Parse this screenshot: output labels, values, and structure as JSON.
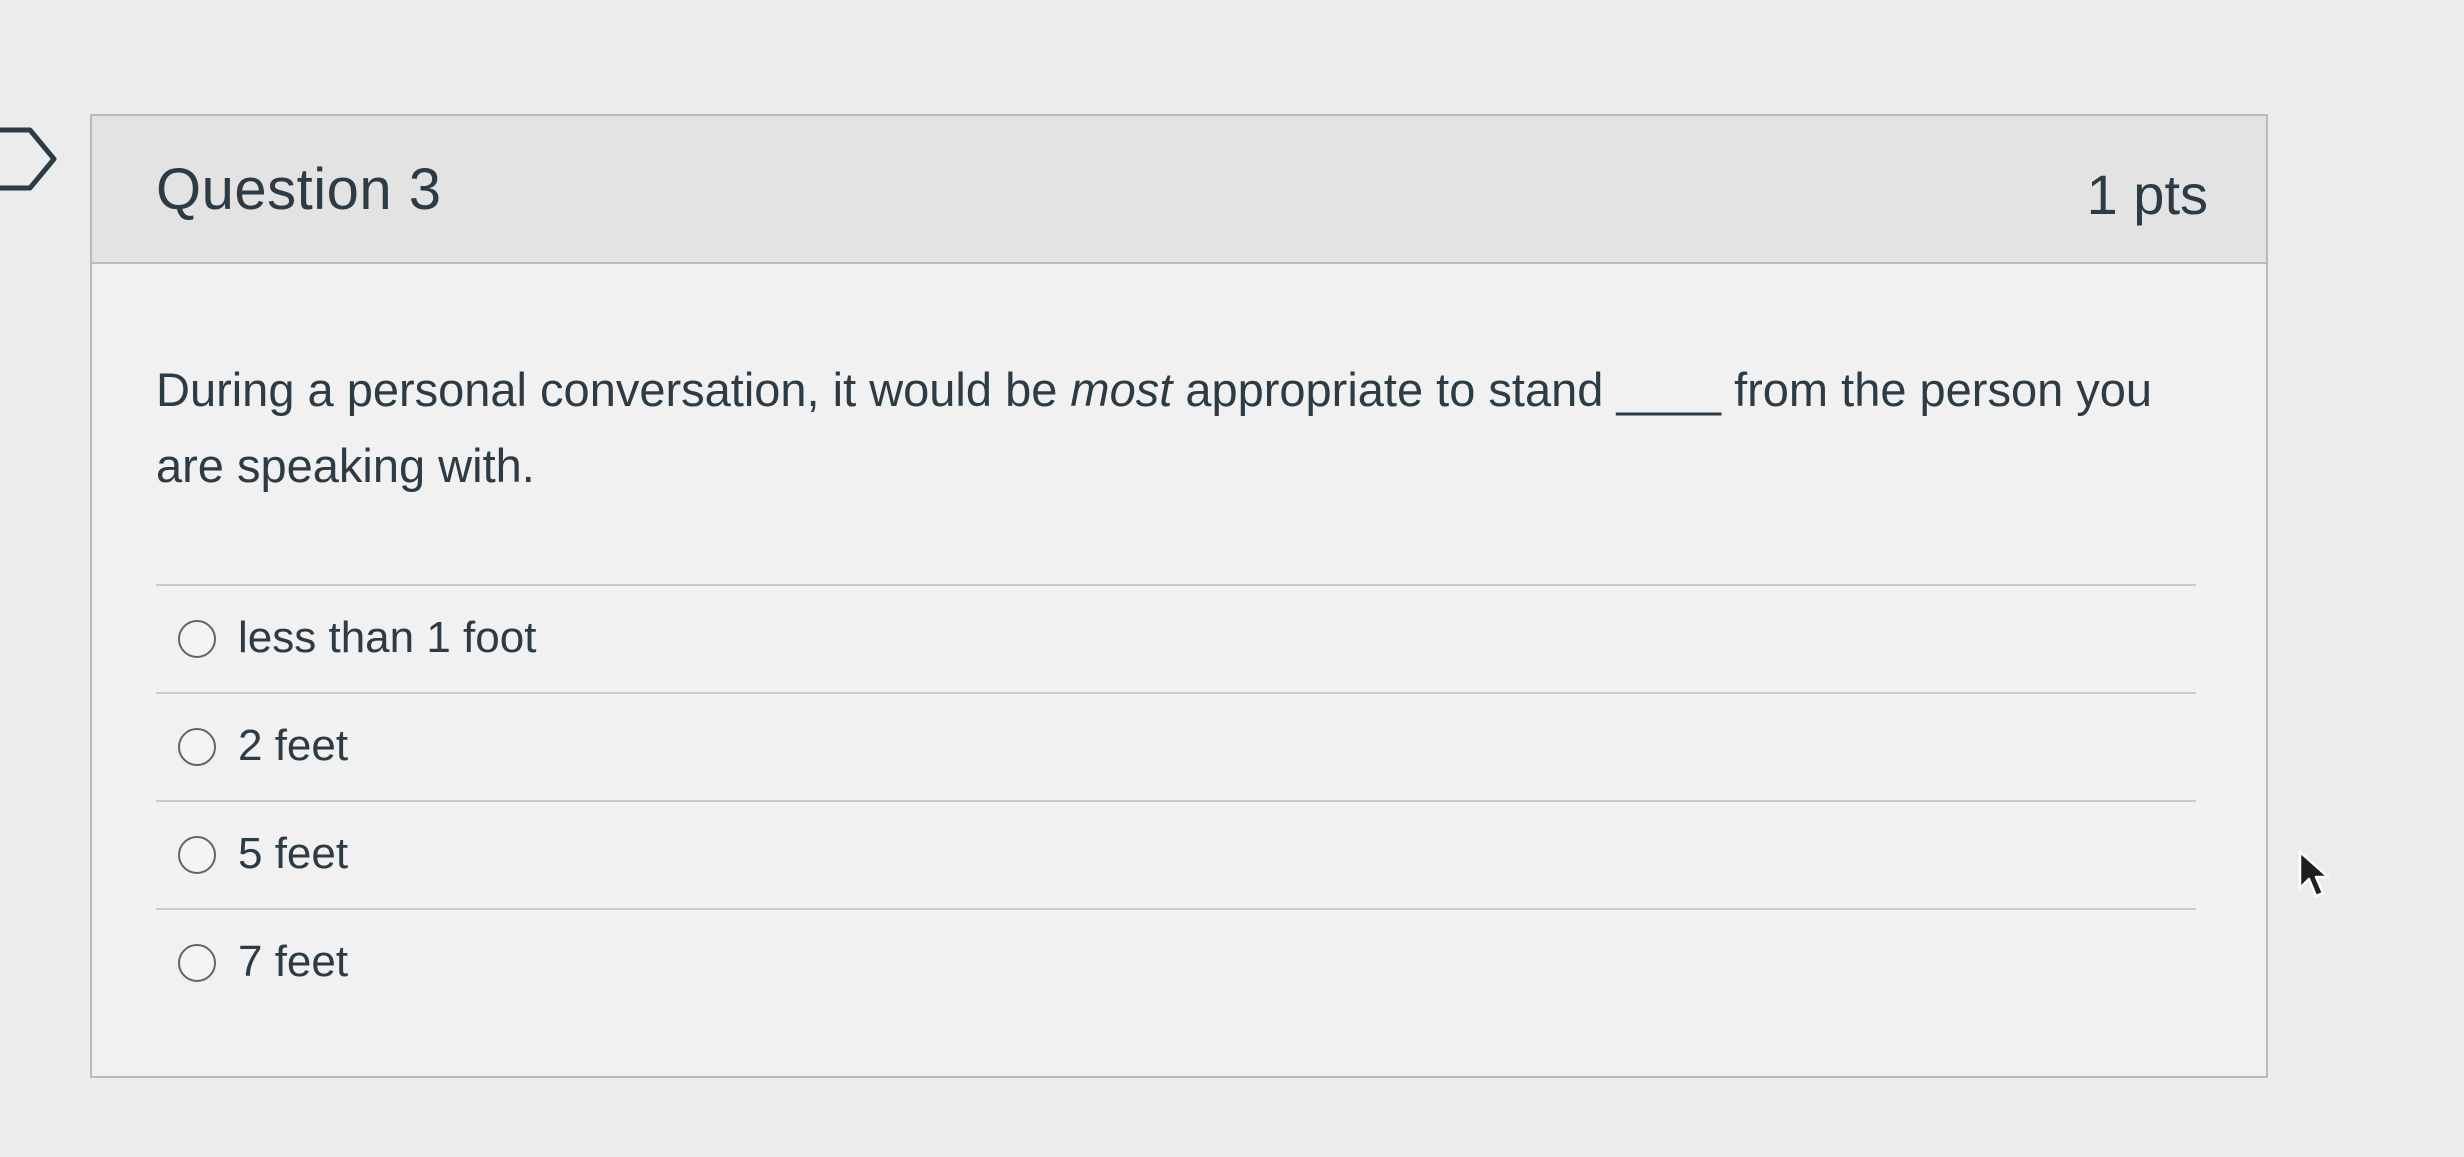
{
  "question": {
    "title": "Question 3",
    "points": "1 pts",
    "text_before": "During a personal conversation, it would be ",
    "text_emphasis": "most",
    "text_after": " appropriate to stand ____ from the person you are speaking with."
  },
  "answers": [
    {
      "label": "less than 1 foot",
      "selected": false
    },
    {
      "label": "2 feet",
      "selected": false
    },
    {
      "label": "5 feet",
      "selected": false
    },
    {
      "label": "7 feet",
      "selected": false
    }
  ],
  "icons": {
    "flag": "flag-question-icon",
    "cursor": "mouse-pointer-icon"
  },
  "colors": {
    "text": "#2d3b45",
    "header_bg": "#e3e3e3",
    "card_bg": "#f1f1f1",
    "border": "#b9bcbf"
  }
}
